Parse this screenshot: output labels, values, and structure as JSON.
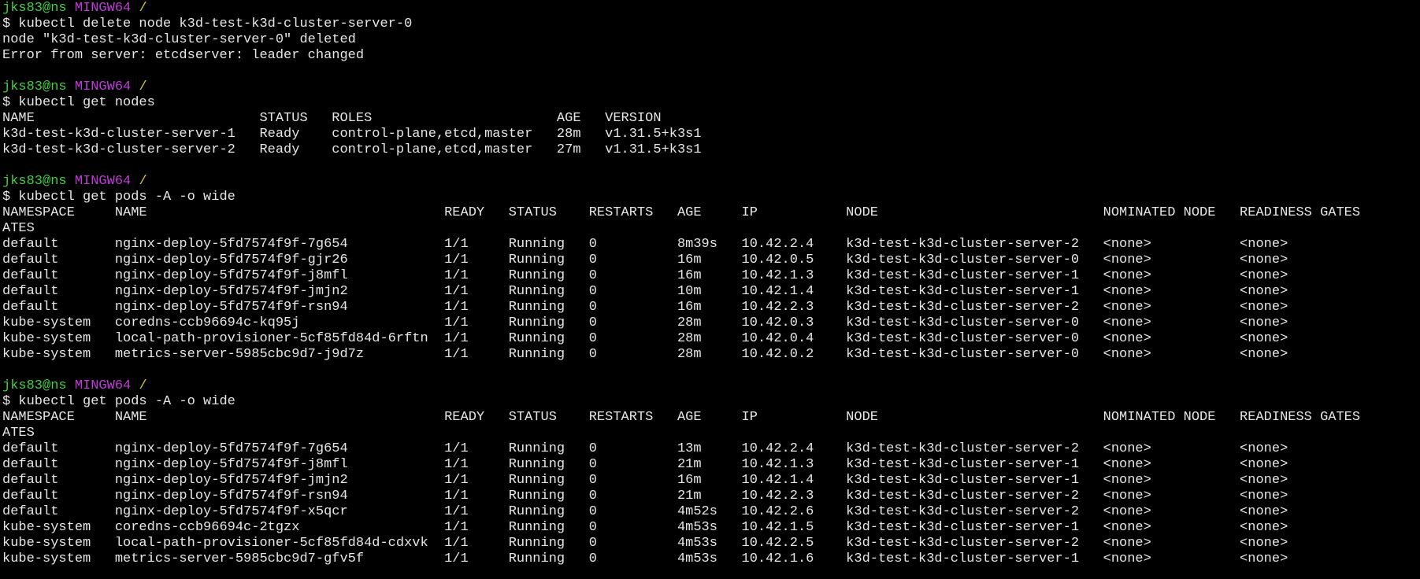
{
  "colors": {
    "background": "#000000",
    "text": "#e6e6e6",
    "prompt_user": "#3fd13f",
    "prompt_host": "#c03ad9",
    "prompt_path": "#d6c43b"
  },
  "lines": [
    {
      "type": "prompt",
      "user": "jks83@ns",
      "host": "MINGW64",
      "path": "/"
    },
    {
      "type": "text",
      "text": "$ kubectl delete node k3d-test-k3d-cluster-server-0"
    },
    {
      "type": "text",
      "text": "node \"k3d-test-k3d-cluster-server-0\" deleted"
    },
    {
      "type": "text",
      "text": "Error from server: etcdserver: leader changed"
    },
    {
      "type": "text",
      "text": ""
    },
    {
      "type": "prompt",
      "user": "jks83@ns",
      "host": "MINGW64",
      "path": "/"
    },
    {
      "type": "text",
      "text": "$ kubectl get nodes"
    },
    {
      "type": "text",
      "text": "NAME                            STATUS   ROLES                       AGE   VERSION"
    },
    {
      "type": "text",
      "text": "k3d-test-k3d-cluster-server-1   Ready    control-plane,etcd,master   28m   v1.31.5+k3s1"
    },
    {
      "type": "text",
      "text": "k3d-test-k3d-cluster-server-2   Ready    control-plane,etcd,master   27m   v1.31.5+k3s1"
    },
    {
      "type": "text",
      "text": ""
    },
    {
      "type": "prompt",
      "user": "jks83@ns",
      "host": "MINGW64",
      "path": "/"
    },
    {
      "type": "text",
      "text": "$ kubectl get pods -A -o wide"
    },
    {
      "type": "text",
      "text": "NAMESPACE     NAME                                     READY   STATUS    RESTARTS   AGE     IP           NODE                            NOMINATED NODE   READINESS GATES"
    },
    {
      "type": "text",
      "text": "ATES"
    },
    {
      "type": "text",
      "text": "default       nginx-deploy-5fd7574f9f-7g654            1/1     Running   0          8m39s   10.42.2.4    k3d-test-k3d-cluster-server-2   <none>           <none>"
    },
    {
      "type": "text",
      "text": "default       nginx-deploy-5fd7574f9f-gjr26            1/1     Running   0          16m     10.42.0.5    k3d-test-k3d-cluster-server-0   <none>           <none>"
    },
    {
      "type": "text",
      "text": "default       nginx-deploy-5fd7574f9f-j8mfl            1/1     Running   0          16m     10.42.1.3    k3d-test-k3d-cluster-server-1   <none>           <none>"
    },
    {
      "type": "text",
      "text": "default       nginx-deploy-5fd7574f9f-jmjn2            1/1     Running   0          10m     10.42.1.4    k3d-test-k3d-cluster-server-1   <none>           <none>"
    },
    {
      "type": "text",
      "text": "default       nginx-deploy-5fd7574f9f-rsn94            1/1     Running   0          16m     10.42.2.3    k3d-test-k3d-cluster-server-2   <none>           <none>"
    },
    {
      "type": "text",
      "text": "kube-system   coredns-ccb96694c-kq95j                  1/1     Running   0          28m     10.42.0.3    k3d-test-k3d-cluster-server-0   <none>           <none>"
    },
    {
      "type": "text",
      "text": "kube-system   local-path-provisioner-5cf85fd84d-6rftn  1/1     Running   0          28m     10.42.0.4    k3d-test-k3d-cluster-server-0   <none>           <none>"
    },
    {
      "type": "text",
      "text": "kube-system   metrics-server-5985cbc9d7-j9d7z          1/1     Running   0          28m     10.42.0.2    k3d-test-k3d-cluster-server-0   <none>           <none>"
    },
    {
      "type": "text",
      "text": ""
    },
    {
      "type": "prompt",
      "user": "jks83@ns",
      "host": "MINGW64",
      "path": "/"
    },
    {
      "type": "text",
      "text": "$ kubectl get pods -A -o wide"
    },
    {
      "type": "text",
      "text": "NAMESPACE     NAME                                     READY   STATUS    RESTARTS   AGE     IP           NODE                            NOMINATED NODE   READINESS GATES"
    },
    {
      "type": "text",
      "text": "ATES"
    },
    {
      "type": "text",
      "text": "default       nginx-deploy-5fd7574f9f-7g654            1/1     Running   0          13m     10.42.2.4    k3d-test-k3d-cluster-server-2   <none>           <none>"
    },
    {
      "type": "text",
      "text": "default       nginx-deploy-5fd7574f9f-j8mfl            1/1     Running   0          21m     10.42.1.3    k3d-test-k3d-cluster-server-1   <none>           <none>"
    },
    {
      "type": "text",
      "text": "default       nginx-deploy-5fd7574f9f-jmjn2            1/1     Running   0          16m     10.42.1.4    k3d-test-k3d-cluster-server-1   <none>           <none>"
    },
    {
      "type": "text",
      "text": "default       nginx-deploy-5fd7574f9f-rsn94            1/1     Running   0          21m     10.42.2.3    k3d-test-k3d-cluster-server-2   <none>           <none>"
    },
    {
      "type": "text",
      "text": "default       nginx-deploy-5fd7574f9f-x5qcr            1/1     Running   0          4m52s   10.42.2.6    k3d-test-k3d-cluster-server-2   <none>           <none>"
    },
    {
      "type": "text",
      "text": "kube-system   coredns-ccb96694c-2tgzx                  1/1     Running   0          4m53s   10.42.1.5    k3d-test-k3d-cluster-server-1   <none>           <none>"
    },
    {
      "type": "text",
      "text": "kube-system   local-path-provisioner-5cf85fd84d-cdxvk  1/1     Running   0          4m53s   10.42.2.5    k3d-test-k3d-cluster-server-2   <none>           <none>"
    },
    {
      "type": "text",
      "text": "kube-system   metrics-server-5985cbc9d7-gfv5f          1/1     Running   0          4m53s   10.42.1.6    k3d-test-k3d-cluster-server-1   <none>           <none>"
    }
  ]
}
